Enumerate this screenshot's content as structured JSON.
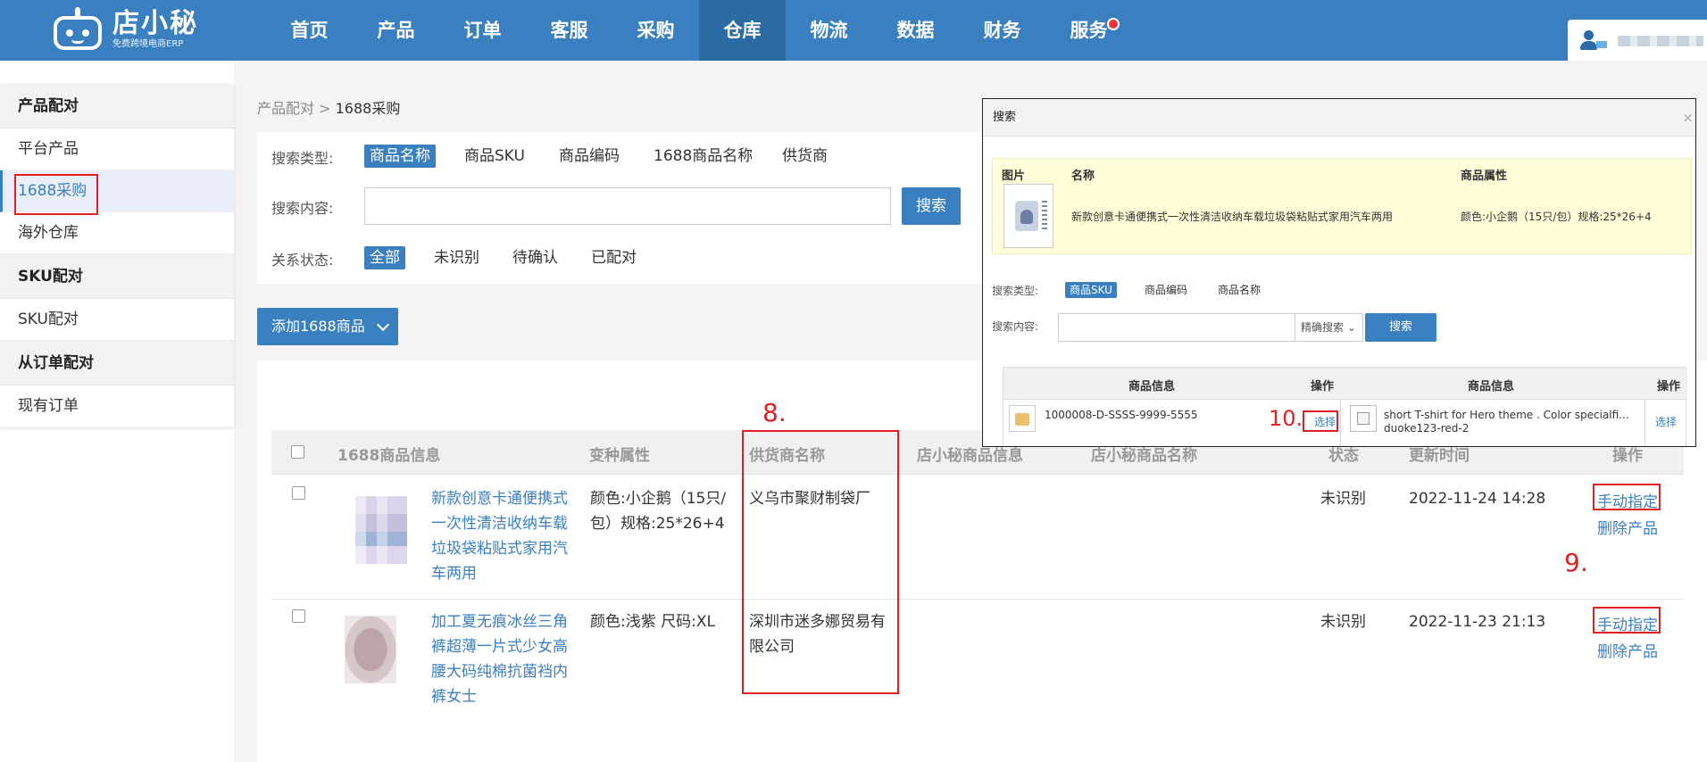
{
  "app": {
    "logo_title": "店小秘",
    "logo_subtitle": "免费跨境电商ERP"
  },
  "nav": {
    "items": [
      "首页",
      "产品",
      "订单",
      "客服",
      "采购",
      "仓库",
      "物流",
      "数据",
      "财务",
      "服务"
    ],
    "active": "仓库"
  },
  "sidebar": {
    "groups": [
      {
        "title": "产品配对",
        "items": [
          "平台产品",
          "1688采购",
          "海外仓库"
        ]
      },
      {
        "title": "SKU配对",
        "items": [
          "SKU配对"
        ]
      },
      {
        "title": "从订单配对",
        "items": [
          "现有订单"
        ]
      }
    ],
    "active_item": "1688采购"
  },
  "breadcrumb": {
    "parent": "产品配对",
    "sep": " > ",
    "current": "1688采购"
  },
  "search": {
    "type_label": "搜索类型:",
    "types": [
      "商品名称",
      "商品SKU",
      "商品编码",
      "1688商品名称",
      "供货商"
    ],
    "active_type": "商品名称",
    "content_label": "搜索内容:",
    "search_button": "搜索",
    "status_label": "关系状态:",
    "statuses": [
      "全部",
      "未识别",
      "待确认",
      "已配对"
    ],
    "active_status": "全部"
  },
  "add_button": "添加1688商品",
  "table": {
    "headers": [
      "1688商品信息",
      "变种属性",
      "供货商名称",
      "店小秘商品信息",
      "店小秘商品名称",
      "状态",
      "更新时间",
      "操作"
    ],
    "rows": [
      {
        "name_lines": [
          "新款创意卡通便携式",
          "一次性清洁收纳车载",
          "垃圾袋粘贴式家用汽",
          "车两用"
        ],
        "variant_lines": [
          "颜色:小企鹅（15只/",
          "包）规格:25*26+4"
        ],
        "supplier_lines": [
          "义乌市聚财制袋厂"
        ],
        "status": "未识别",
        "updated": "2022-11-24 14:28",
        "action_assign": "手动指定",
        "action_delete": "删除产品"
      },
      {
        "name_lines": [
          "加工夏无痕冰丝三角",
          "裤超薄一片式少女高",
          "腰大码纯棉抗菌裆内",
          "裤女士"
        ],
        "variant_lines": [
          "颜色:浅紫 尺码:XL"
        ],
        "supplier_lines": [
          "深圳市迷多娜贸易有",
          "限公司"
        ],
        "status": "未识别",
        "updated": "2022-11-23 21:13",
        "action_assign": "手动指定",
        "action_delete": "删除产品"
      }
    ]
  },
  "annotations": {
    "a8": "8.",
    "a9": "9.",
    "a10": "10."
  },
  "dialog": {
    "title": "搜索",
    "close": "×",
    "product": {
      "col_image": "图片",
      "col_name": "名称",
      "col_attr": "商品属性",
      "name": "新款创意卡通便携式一次性清洁收纳车载垃圾袋粘贴式家用汽车两用",
      "attr": "颜色:小企鹅（15只/包）规格:25*26+4"
    },
    "type_label": "搜索类型:",
    "types": [
      "商品SKU",
      "商品编码",
      "商品名称"
    ],
    "active_type": "商品SKU",
    "content_label": "搜索内容:",
    "match_mode": "精确搜索",
    "search_button": "搜索",
    "results": {
      "col_info": "商品信息",
      "col_action": "操作",
      "left": {
        "sku": "1000008-D-SSSS-9999-5555",
        "action": "选择"
      },
      "right": {
        "line1": "short T-shirt for Hero theme . Color specialfi...",
        "line2": "duoke123-red-2",
        "action": "选择"
      }
    }
  }
}
